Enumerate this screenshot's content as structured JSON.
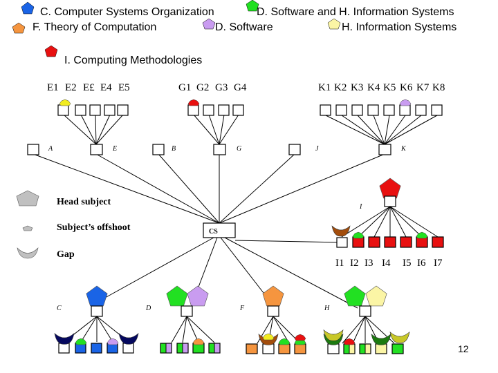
{
  "colors": {
    "C": "#1a64e6",
    "D": "#22e022",
    "F": "#f5953f",
    "Dsoft": "#c99cf0",
    "H": "#fbf5a5",
    "I": "#e81010",
    "navy": "#05085e",
    "yellow": "#f2ec20",
    "brown": "#a34d0c",
    "darkgreen": "#1c7a10",
    "olive": "#c8c828",
    "gray": "#c0c0c0",
    "white": "#ffffff"
  },
  "legend_top": [
    {
      "id": "C",
      "label": "C. Computer Systems Organization",
      "color": "C"
    },
    {
      "id": "DH",
      "label": "D. Software and H. Information Systems",
      "color": "D"
    },
    {
      "id": "F",
      "label": "F. Theory of Computation",
      "color": "F"
    },
    {
      "id": "Dsoft",
      "label": "D. Software",
      "color": "Dsoft"
    },
    {
      "id": "H",
      "label": "H. Information Systems",
      "color": "H"
    },
    {
      "id": "I",
      "label": "I. Computing Methodologies",
      "color": "I"
    }
  ],
  "legend_shapes": {
    "head_subject": "Head subject",
    "offshoot": "Subject’s offshoot",
    "gap": "Gap"
  },
  "root": {
    "label": "CS"
  },
  "upper_nodes": {
    "A": "A",
    "E": "E",
    "B": "B",
    "G": "G",
    "J": "J",
    "K": "K",
    "I": "I"
  },
  "lower_nodes": {
    "C": "C",
    "D": "D",
    "F": "F",
    "H": "H"
  },
  "children_labels": {
    "E": [
      "E1",
      "E2",
      "E£",
      "E4",
      "E5"
    ],
    "G": [
      "G1",
      "G2",
      "G3",
      "G4"
    ],
    "K": [
      "K1",
      "K2",
      "K3",
      "K4",
      "K5",
      "K6",
      "K7",
      "K8"
    ],
    "I": [
      "I1",
      "I2",
      "I3",
      "I4",
      "I5",
      "I6",
      "I7"
    ]
  },
  "page_number": "12"
}
